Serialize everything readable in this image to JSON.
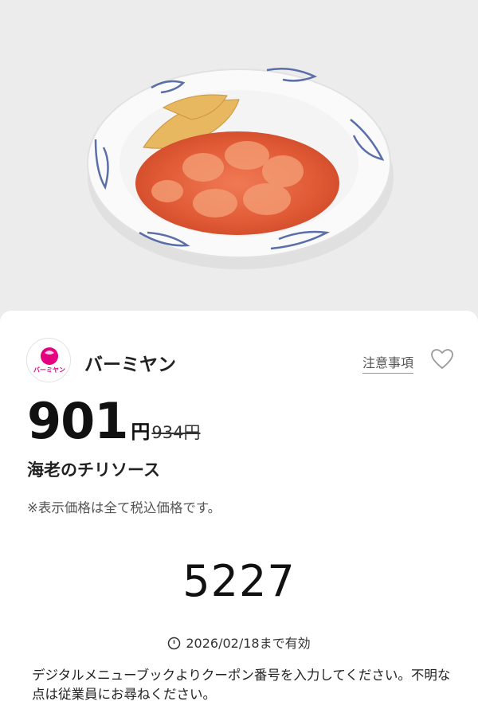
{
  "hero": {
    "image": "shrimp-chili-sauce-dish-photo"
  },
  "brand": {
    "name": "バーミヤン",
    "logo_text": "バーミヤン",
    "logo_color": "#e4007f"
  },
  "notes_link": "注意事項",
  "favorite_icon": "heart-outline-icon",
  "price": {
    "current": "901",
    "currency": "円",
    "original": "934円"
  },
  "item": {
    "name": "海老のチリソース"
  },
  "tax_note": "※表示価格は全て税込価格です。",
  "coupon": {
    "code": "5227"
  },
  "expiry": {
    "icon": "clock-icon",
    "text": "2026/02/18まで有効"
  },
  "instructions": "デジタルメニューブックよりクーポン番号を入力してください。不明な点は従業員にお尋ねください。"
}
